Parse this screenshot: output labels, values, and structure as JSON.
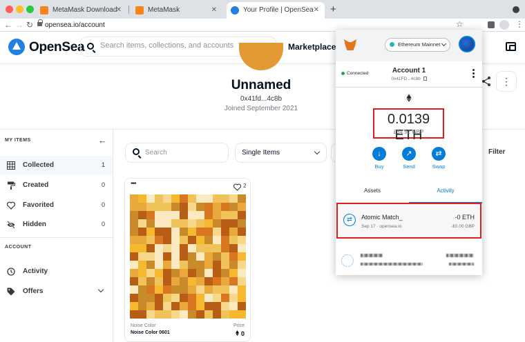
{
  "browser": {
    "tabs": [
      {
        "title": "MetaMask Download"
      },
      {
        "title": "MetaMask"
      },
      {
        "title": "Your Profile | OpenSea"
      }
    ],
    "new_tab": "+",
    "url": "opensea.io/account"
  },
  "header": {
    "brand": "OpenSea",
    "search_placeholder": "Search items, collections, and accounts",
    "nav": "Marketplace"
  },
  "profile": {
    "name": "Unnamed",
    "address": "0x41fd...4c8b",
    "joined": "Joined September 2021"
  },
  "sidebar": {
    "my_items_heading": "MY ITEMS",
    "items": [
      {
        "label": "Collected",
        "count": "1",
        "icon": "grid-icon"
      },
      {
        "label": "Created",
        "count": "0",
        "icon": "paint-roller-icon"
      },
      {
        "label": "Favorited",
        "count": "0",
        "icon": "heart-icon"
      },
      {
        "label": "Hidden",
        "count": "0",
        "icon": "eye-off-icon"
      }
    ],
    "account_heading": "ACCOUNT",
    "account_items": [
      {
        "label": "Activity",
        "icon": "history-icon"
      },
      {
        "label": "Offers",
        "icon": "tag-icon"
      }
    ]
  },
  "filters": {
    "search_placeholder": "Search",
    "type_select": "Single Items",
    "filter_label": "Filter"
  },
  "card": {
    "likes": "2",
    "collection": "Noise Color",
    "name": "Noise Color 0601",
    "price_label": "Price",
    "price": "0"
  },
  "metamask": {
    "network": "Ethereum Mainnet",
    "connected": "Connected",
    "account_name": "Account 1",
    "account_address": "0x41FD...4c8b",
    "balance": "0.0139 ETH",
    "fiat": "£34.92 GBP",
    "actions": [
      {
        "label": "Buy",
        "icon": "download-icon"
      },
      {
        "label": "Send",
        "icon": "arrow-up-right-icon"
      },
      {
        "label": "Swap",
        "icon": "swap-icon"
      }
    ],
    "tabs": [
      "Assets",
      "Activity"
    ],
    "active_tab": "Activity",
    "tx": {
      "title": "Atomic Match_",
      "date": "Sep 17 · opensea.io",
      "amount": "-0 ETH",
      "fiat": "-£0.00 GBP"
    }
  },
  "colors": {
    "opensea_blue": "#2081e2",
    "metamask_blue": "#037dd6",
    "highlight_red": "#e41b1b",
    "nft_orange": "#e8a93a"
  }
}
